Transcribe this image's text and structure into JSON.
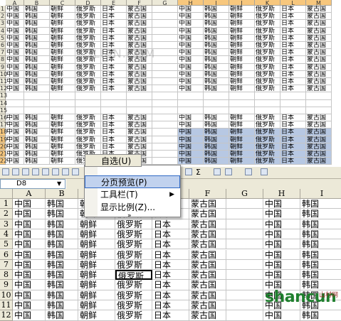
{
  "top_sheet": {
    "col_headers": [
      "A",
      "B",
      "C",
      "D",
      "E",
      "F",
      "G",
      "H",
      "I",
      "J",
      "K",
      "L",
      "M"
    ],
    "row_headers": [
      "1",
      "2",
      "3",
      "4",
      "5",
      "6",
      "7",
      "8",
      "9",
      "10",
      "11",
      "12",
      "13",
      "14",
      "15",
      "16",
      "17",
      "18",
      "19",
      "20",
      "21",
      "22"
    ],
    "row_words": [
      "中国",
      "韩国",
      "朝鲜",
      "俄罗斯",
      "日本",
      "蒙古国"
    ],
    "watermark": "3LIAN.COM"
  },
  "bottom_sheet": {
    "toolbar_menu_label": "自选(U)",
    "name_box": "D8",
    "context_menu": {
      "items": [
        {
          "label": "分页预览(P)",
          "highlighted": true
        },
        {
          "label": "工具栏(T)",
          "has_submenu": true
        },
        {
          "label": "显示比例(Z)..."
        },
        {
          "label": "»"
        }
      ]
    },
    "col_headers": [
      "A",
      "B",
      "C",
      "D",
      "E",
      "F",
      "G",
      "H",
      "I"
    ],
    "row_headers": [
      "1",
      "2",
      "3",
      "4",
      "5",
      "6",
      "7",
      "8",
      "9",
      "10",
      "11",
      "12"
    ],
    "rows": [
      [
        "中国",
        "韩国",
        "朝鲜",
        "俄罗斯",
        "日本",
        "蒙古国",
        "",
        "中国",
        "韩国"
      ],
      [
        "中国",
        "韩国",
        "朝鲜",
        "俄罗斯",
        "日本",
        "蒙古国",
        "",
        "中国",
        "韩国"
      ],
      [
        "中国",
        "韩国",
        "朝鲜",
        "俄罗斯",
        "日本",
        "蒙古国",
        "",
        "中国",
        "韩国"
      ],
      [
        "中国",
        "韩国",
        "朝鲜",
        "俄罗斯",
        "日本",
        "蒙古国",
        "",
        "中国",
        "韩国"
      ],
      [
        "中国",
        "韩国",
        "朝鲜",
        "俄罗斯",
        "日本",
        "蒙古国",
        "",
        "中国",
        "韩国"
      ],
      [
        "中国",
        "韩国",
        "朝鲜",
        "俄罗斯",
        "日本",
        "蒙古国",
        "",
        "中国",
        "韩国"
      ],
      [
        "中国",
        "韩国",
        "朝鲜",
        "俄罗斯",
        "日本",
        "蒙古国",
        "",
        "中国",
        "韩国"
      ],
      [
        "中国",
        "韩国",
        "朝鲜",
        "俄罗斯",
        "日本",
        "蒙古国",
        "",
        "中国",
        "韩国"
      ],
      [
        "中国",
        "韩国",
        "朝鲜",
        "俄罗斯",
        "日本",
        "蒙古国",
        "",
        "中国",
        "韩国"
      ],
      [
        "中国",
        "韩国",
        "朝鲜",
        "俄罗斯",
        "日本",
        "蒙古国",
        "",
        "中国",
        "韩国"
      ],
      [
        "中国",
        "韩国",
        "朝鲜",
        "俄罗斯",
        "日本",
        "蒙古国",
        "",
        "中国",
        "韩国"
      ],
      [
        "中国",
        "韩国",
        "朝鲜",
        "俄罗斯",
        "日本",
        "蒙古国",
        "",
        "中国",
        "韩国"
      ]
    ],
    "selected_cell": "D8"
  },
  "logo": {
    "text": "shancun",
    "sub": "山村网"
  },
  "colors": {
    "selection": "#b7c8e3",
    "selected_header": "#f7c77d",
    "header_bg": "#ece9d8",
    "logo_green": "#1f7f2e"
  }
}
